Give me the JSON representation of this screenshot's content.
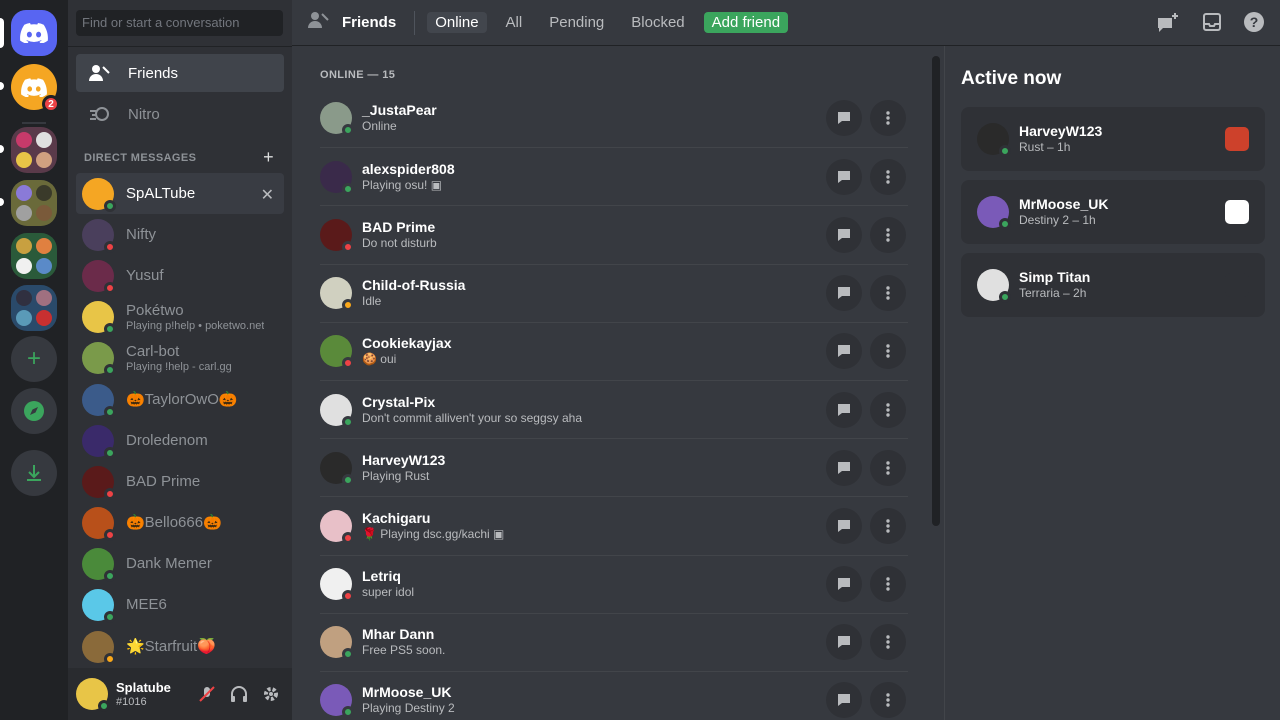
{
  "rail": {
    "home_icon": "discord-logo-icon",
    "dm_badge": "2",
    "add_server": "+",
    "explore_icon": "compass-icon",
    "download_icon": "download-icon"
  },
  "sidebar": {
    "search_placeholder": "Find or start a conversation",
    "nav": [
      {
        "label": "Friends",
        "icon": "friends-icon"
      },
      {
        "label": "Nitro",
        "icon": "nitro-icon"
      }
    ],
    "dm_header": "DIRECT MESSAGES",
    "dms": [
      {
        "name": "SpALTube",
        "sub": "",
        "status": "online",
        "color": "#f5a623"
      },
      {
        "name": "Nifty",
        "sub": "",
        "status": "dnd",
        "color": "#4a3f5c"
      },
      {
        "name": "Yusuf",
        "sub": "",
        "status": "dnd",
        "color": "#6b2b4a"
      },
      {
        "name": "Pokétwo",
        "sub": "Playing p!help • poketwo.net",
        "status": "online",
        "color": "#e8c547"
      },
      {
        "name": "Carl-bot",
        "sub": "Playing !help - carl.gg",
        "status": "online",
        "color": "#7a9a4a"
      },
      {
        "name": "🎃TaylorOwO🎃",
        "sub": "",
        "status": "online",
        "color": "#3b5b8a"
      },
      {
        "name": "Droledenom",
        "sub": "",
        "status": "online",
        "color": "#3a2a6a"
      },
      {
        "name": "BAD Prime",
        "sub": "",
        "status": "dnd",
        "color": "#5a1a1a"
      },
      {
        "name": "🎃Bello666🎃",
        "sub": "",
        "status": "dnd",
        "color": "#b8501a"
      },
      {
        "name": "Dank Memer",
        "sub": "",
        "status": "online",
        "color": "#4a8a3a"
      },
      {
        "name": "MEE6",
        "sub": "",
        "status": "online",
        "color": "#5ac8e8"
      },
      {
        "name": "🌟Starfruit🍑",
        "sub": "",
        "status": "idle",
        "color": "#8a6a3a"
      }
    ],
    "user": {
      "name": "Splatube",
      "tag": "#1016"
    }
  },
  "topbar": {
    "title": "Friends",
    "tabs": [
      "Online",
      "All",
      "Pending",
      "Blocked"
    ],
    "add_friend": "Add friend"
  },
  "friends": {
    "header": "ONLINE — 15",
    "list": [
      {
        "name": "_JustaPear",
        "status_text": "Online",
        "status": "online",
        "color": "#8a9a8a"
      },
      {
        "name": "alexspider808",
        "status_text": "Playing osu! ▣",
        "status": "online",
        "color": "#3a2a4a"
      },
      {
        "name": "BAD Prime",
        "status_text": "Do not disturb",
        "status": "dnd",
        "color": "#5a1a1a"
      },
      {
        "name": "Child-of-Russia",
        "status_text": "Idle",
        "status": "idle",
        "color": "#d0d0c0"
      },
      {
        "name": "Cookiekayjax",
        "status_text": "🍪 oui",
        "status": "dnd",
        "color": "#5a8a3a"
      },
      {
        "name": "Crystal-Pix",
        "status_text": "Don't commit alliven't your so seggsy aha",
        "status": "online",
        "color": "#e0e0e0"
      },
      {
        "name": "HarveyW123",
        "status_text": "Playing Rust",
        "status": "online",
        "color": "#2a2a2a"
      },
      {
        "name": "Kachigaru",
        "status_text": "🌹 Playing dsc.gg/kachi ▣",
        "status": "dnd",
        "color": "#e8c0c8"
      },
      {
        "name": "Letriq",
        "status_text": "super idol",
        "status": "dnd",
        "color": "#f0f0f0"
      },
      {
        "name": "Mhar Dann",
        "status_text": "Free PS5 soon.",
        "status": "online",
        "color": "#c0a080"
      },
      {
        "name": "MrMoose_UK",
        "status_text": "Playing Destiny 2",
        "status": "online",
        "color": "#7a5ab8"
      }
    ]
  },
  "active_now": {
    "title": "Active now",
    "cards": [
      {
        "name": "HarveyW123",
        "game": "Rust – 1h",
        "color": "#2a2a2a",
        "icon_bg": "#cd412b",
        "icon": "rust-game-icon"
      },
      {
        "name": "MrMoose_UK",
        "game": "Destiny 2 – 1h",
        "color": "#7a5ab8",
        "icon_bg": "#ffffff",
        "icon": "destiny-game-icon"
      },
      {
        "name": "Simp Titan",
        "game": "Terraria – 2h",
        "color": "#e0e0e0",
        "icon_bg": "#2f3136",
        "icon": "terraria-game-icon"
      }
    ]
  },
  "colors": {
    "online": "#3ba55d",
    "dnd": "#ed4245",
    "idle": "#faa81a",
    "accent": "#5865f2"
  }
}
